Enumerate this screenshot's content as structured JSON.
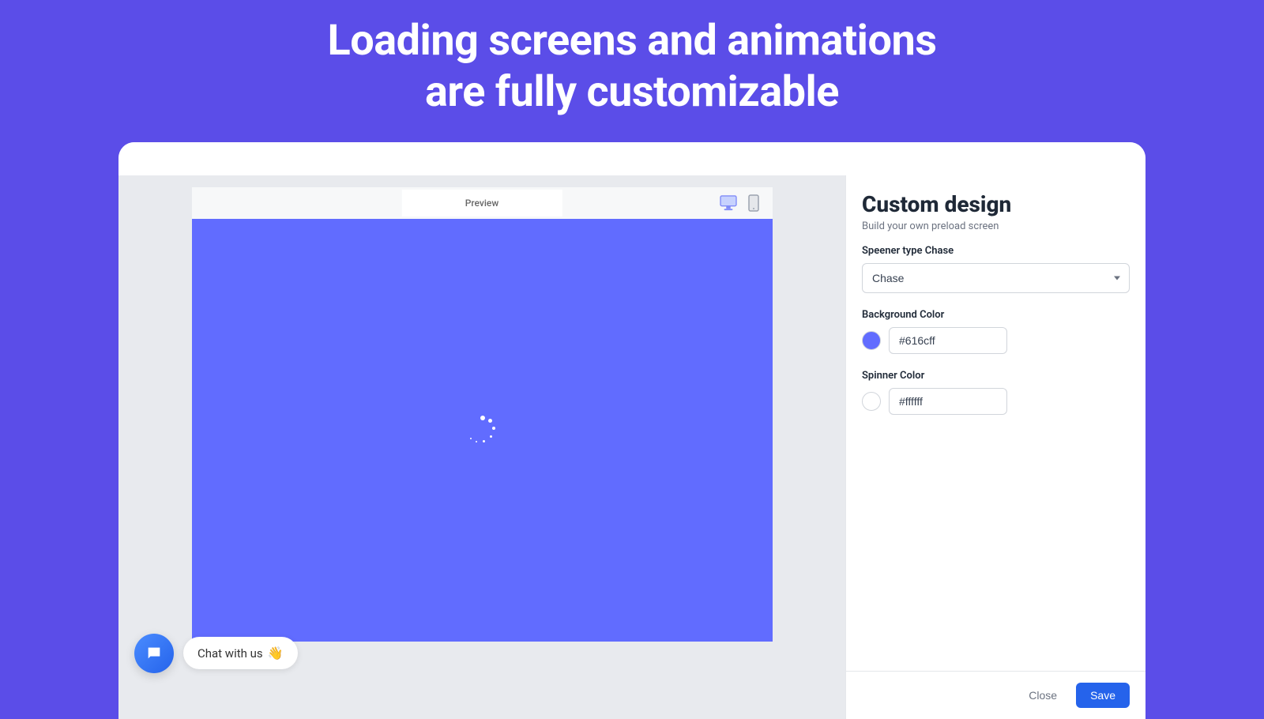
{
  "hero": {
    "line1": "Loading screens and animations",
    "line2": "are fully customizable"
  },
  "preview": {
    "tab_label": "Preview",
    "background_color": "#616cff",
    "spinner_color": "#ffffff"
  },
  "chat": {
    "label": "Chat with us",
    "emoji": "👋"
  },
  "panel": {
    "title": "Custom design",
    "subtitle": "Build your own preload screen",
    "spinner_type": {
      "label": "Speener type Chase",
      "value": "Chase"
    },
    "background_color": {
      "label": "Background Color",
      "value": "#616cff"
    },
    "spinner_color": {
      "label": "Spinner Color",
      "value": "#ffffff"
    },
    "close_label": "Close",
    "save_label": "Save"
  }
}
